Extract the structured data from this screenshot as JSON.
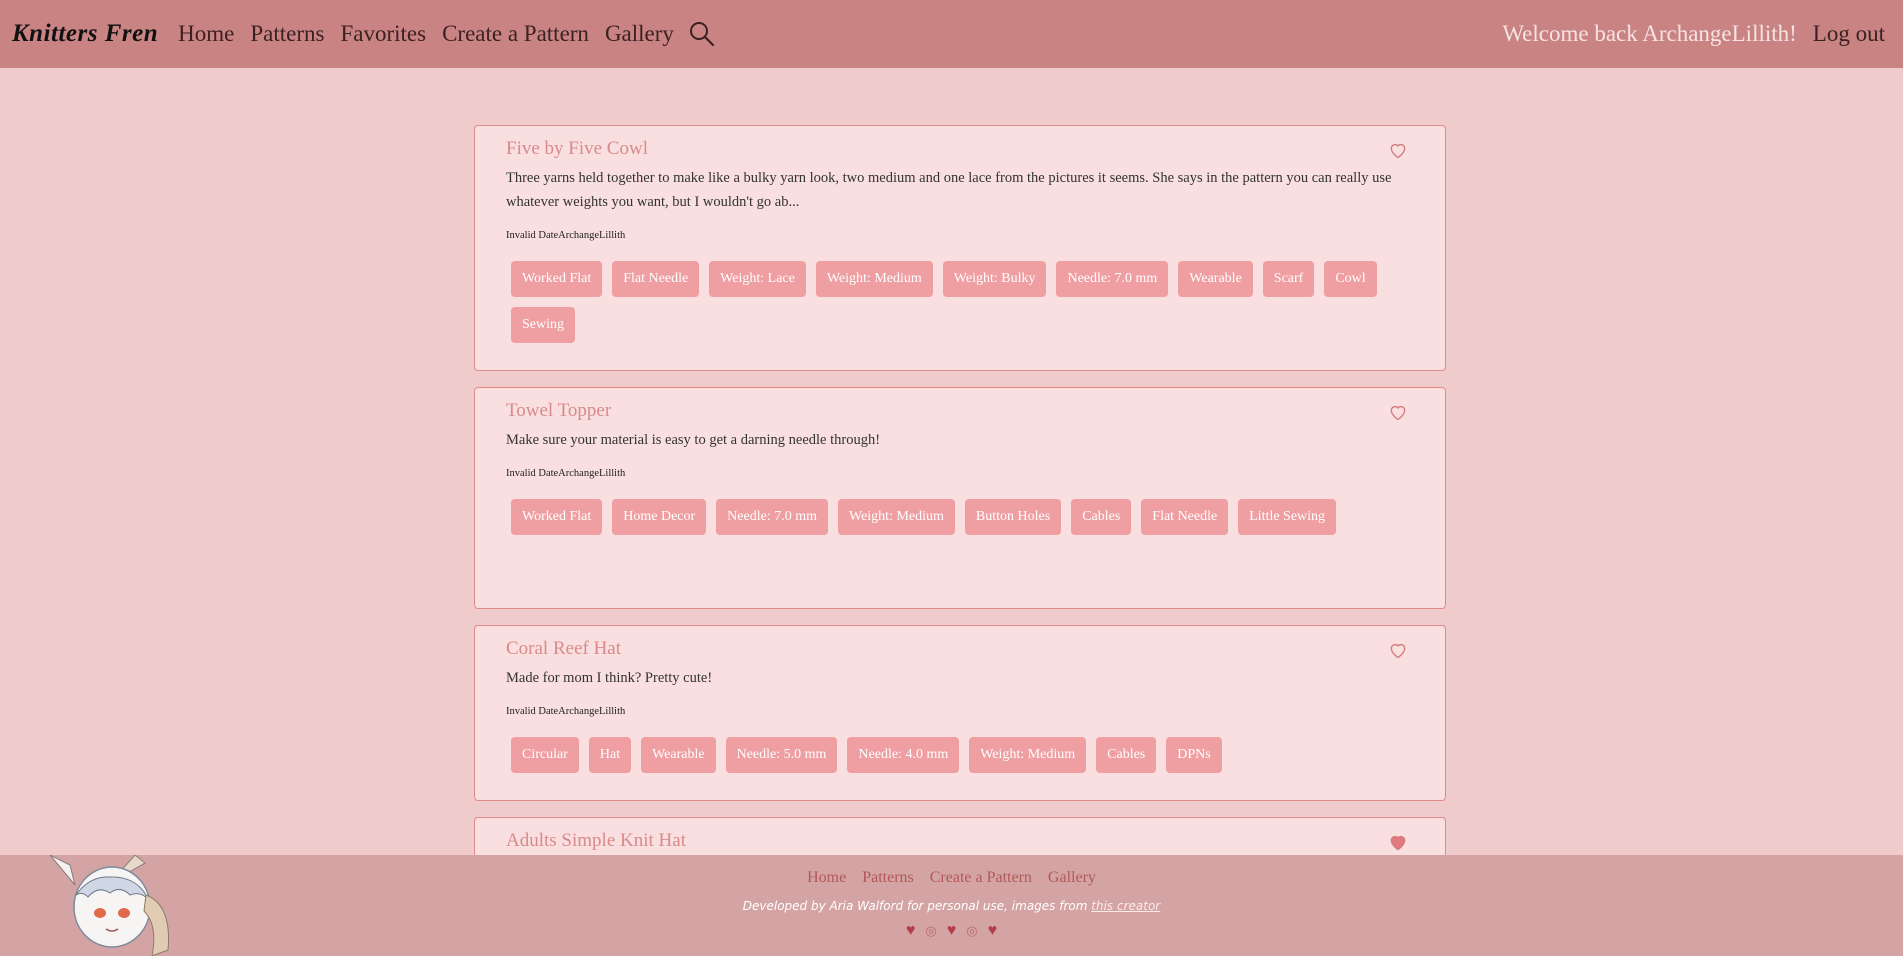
{
  "nav": {
    "brand": "Knitters Fren",
    "links": [
      "Home",
      "Patterns",
      "Favorites",
      "Create a Pattern",
      "Gallery"
    ],
    "welcome": "Welcome back ArchangeLillith!",
    "logout": "Log out"
  },
  "patterns": [
    {
      "title": "Five by Five Cowl",
      "description": "Three yarns held together to make like a bulky yarn look, two medium and one lace from the pictures it seems. She says in the pattern you can really use whatever weights you want, but I wouldn't go ab...",
      "meta": "Invalid DateArchangeLillith",
      "favorited": false,
      "tags": [
        "Worked Flat",
        "Flat Needle",
        "Weight: Lace",
        "Weight: Medium",
        "Weight: Bulky",
        "Needle: 7.0 mm",
        "Wearable",
        "Scarf",
        "Cowl",
        "Sewing"
      ]
    },
    {
      "title": "Towel Topper",
      "description": "Make sure your material is easy to get a darning needle through!",
      "meta": "Invalid DateArchangeLillith",
      "favorited": false,
      "tags": [
        "Worked Flat",
        "Home Decor",
        "Needle: 7.0 mm",
        "Weight: Medium",
        "Button Holes",
        "Cables",
        "Flat Needle",
        "Little Sewing"
      ]
    },
    {
      "title": "Coral Reef Hat",
      "description": "Made for mom I think? Pretty cute!",
      "meta": "Invalid DateArchangeLillith",
      "favorited": false,
      "tags": [
        "Circular",
        "Hat",
        "Wearable",
        "Needle: 5.0 mm",
        "Needle: 4.0 mm",
        "Weight: Medium",
        "Cables",
        "DPNs"
      ]
    },
    {
      "title": "Adults Simple Knit Hat",
      "description": "",
      "meta": "",
      "favorited": true,
      "tags": []
    }
  ],
  "footer": {
    "links": [
      "Home",
      "Patterns",
      "Create a Pattern",
      "Gallery"
    ],
    "credit_text": "Developed by Aria Walford for personal use, images from",
    "credit_link": "this creator"
  },
  "colors": {
    "nav_bg": "#c98383",
    "page_bg": "#f0cbcb",
    "card_bg": "#f9dfdf",
    "tag_bg": "#ef9ea2",
    "footer_bg": "#d4a4a4"
  }
}
